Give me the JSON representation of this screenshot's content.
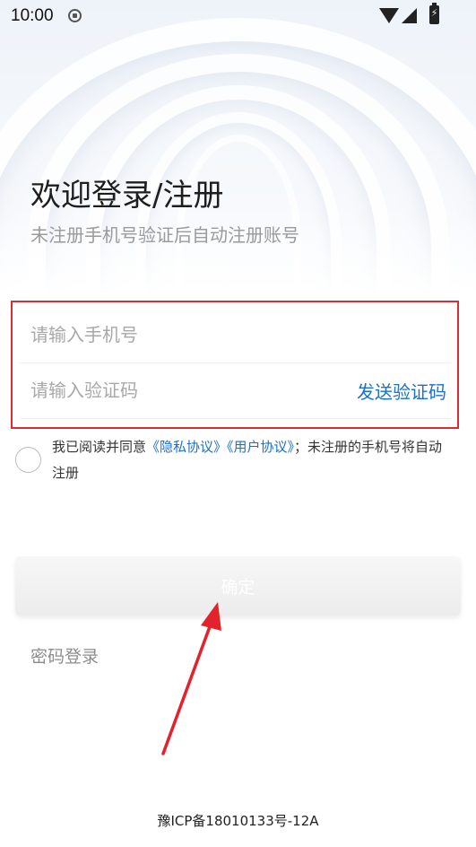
{
  "status_bar": {
    "time": "10:00",
    "icons": [
      "shield-icon",
      "wifi-icon",
      "signal-icon",
      "battery-charging-icon"
    ]
  },
  "header": {
    "title": "欢迎登录/注册",
    "subtitle": "未注册手机号验证后自动注册账号"
  },
  "form": {
    "phone_placeholder": "请输入手机号",
    "phone_value": "",
    "code_placeholder": "请输入验证码",
    "code_value": "",
    "send_code_label": "发送验证码",
    "highlight_color": "#d62d36"
  },
  "agreement": {
    "prefix": "我已阅读并同意",
    "privacy_link": "《隐私协议》",
    "user_link": "《用户协议》",
    "suffix": "；未注册的手机号将自动注册",
    "checked": false
  },
  "actions": {
    "confirm_label": "确定",
    "password_login_label": "密码登录"
  },
  "annotation": {
    "arrow_color": "#e3232c",
    "points_to": "confirm-button"
  },
  "footer": {
    "icp": "豫ICP备18010133号-12A"
  },
  "colors": {
    "link": "#1b6fd1",
    "placeholder": "#a8a8a8"
  }
}
